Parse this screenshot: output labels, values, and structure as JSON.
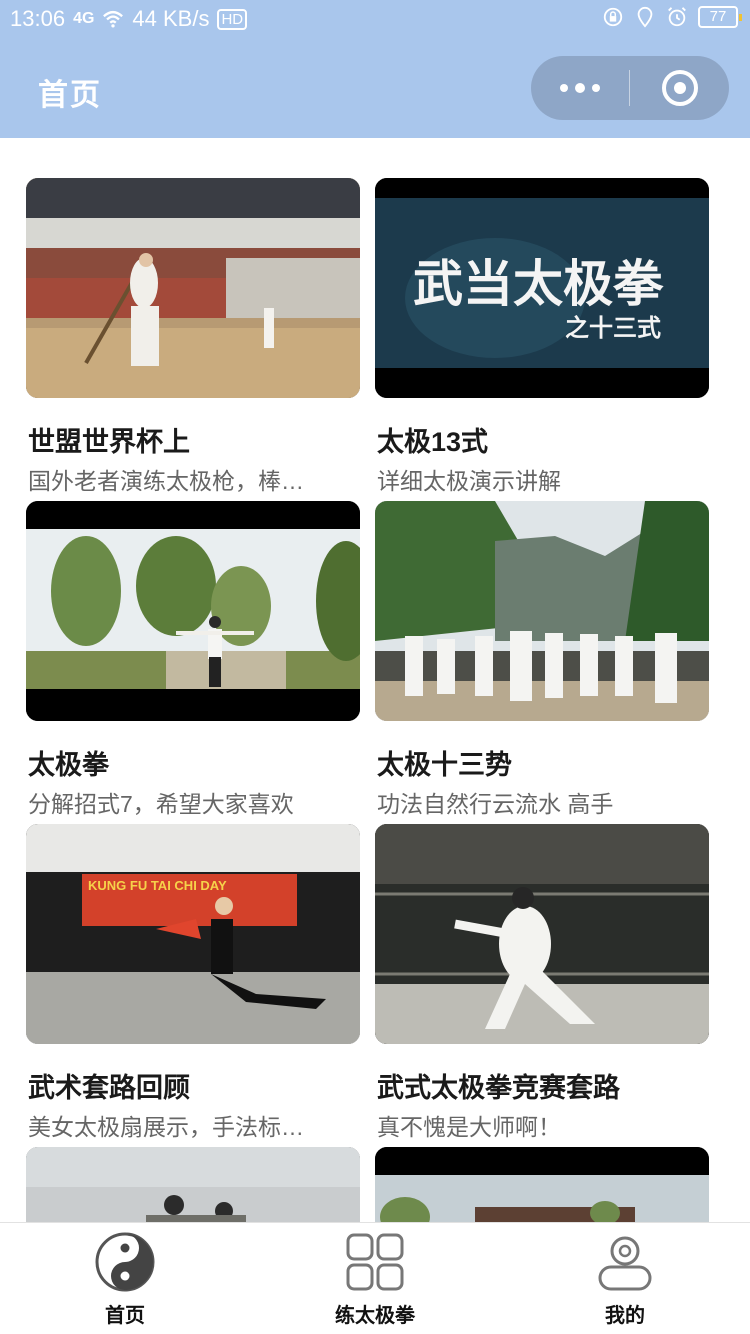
{
  "status_bar": {
    "time": "13:06",
    "signal": "4G",
    "speed": "44 KB/s",
    "hd": "HD",
    "battery": "77"
  },
  "nav": {
    "title": "首页"
  },
  "videos": [
    {
      "title": "世盟世界杯上",
      "desc": "国外老者演练太极枪，棒…"
    },
    {
      "title": "太极13式",
      "desc": "详细太极演示讲解",
      "thumb_text": "武当太极拳",
      "thumb_subtext": "之十三式"
    },
    {
      "title": "太极拳",
      "desc": "分解招式7，希望大家喜欢"
    },
    {
      "title": "太极十三势",
      "desc": "功法自然行云流水 高手"
    },
    {
      "title": "武术套路回顾",
      "desc": "美女太极扇展示，手法标…",
      "thumb_banner": "KUNG FU TAI CHI DAY"
    },
    {
      "title": "武式太极拳竞赛套路",
      "desc": "真不愧是大师啊！"
    },
    {
      "title": "",
      "desc": ""
    },
    {
      "title": "",
      "desc": ""
    }
  ],
  "tabs": [
    {
      "label": "首页",
      "icon": "yin-yang-icon",
      "active": true
    },
    {
      "label": "练太极拳",
      "icon": "grid-icon",
      "active": false
    },
    {
      "label": "我的",
      "icon": "user-icon",
      "active": false
    }
  ],
  "colors": {
    "header_bg": "#a9c6ec",
    "title_text": "#1a1a1a",
    "desc_text": "#666666"
  }
}
